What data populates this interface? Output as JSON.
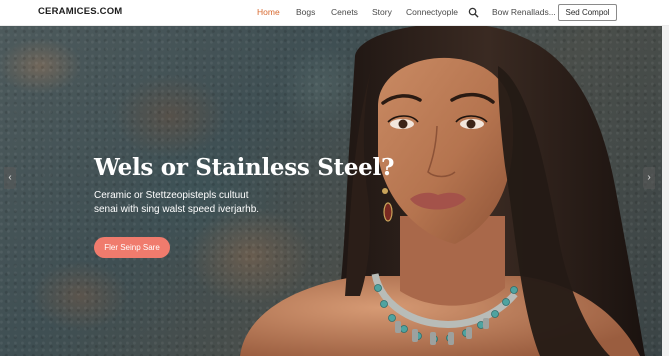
{
  "site": {
    "logo": "CERAMICES.COM"
  },
  "nav": {
    "items": [
      {
        "label": "Home",
        "active": true
      },
      {
        "label": "Bogs",
        "active": false
      },
      {
        "label": "Cenets",
        "active": false
      },
      {
        "label": "Story",
        "active": false
      },
      {
        "label": "Connectyople",
        "active": false
      },
      {
        "label": "Bow Renallads...",
        "active": false
      }
    ],
    "search_icon": "search-icon",
    "cta_label": "Sed Compol"
  },
  "hero": {
    "title": "Wels or Stainless Steel?",
    "subtitle": "Ceramic or Stettzeopistepls cultuut senai with sing walst speed iverjarhb.",
    "button_label": "Fler Seinp Sare",
    "prev_icon": "chevron-left-icon",
    "next_icon": "chevron-right-icon"
  },
  "colors": {
    "accent": "#d8692f",
    "button": "#f07b6d",
    "title": "#ffffff"
  }
}
